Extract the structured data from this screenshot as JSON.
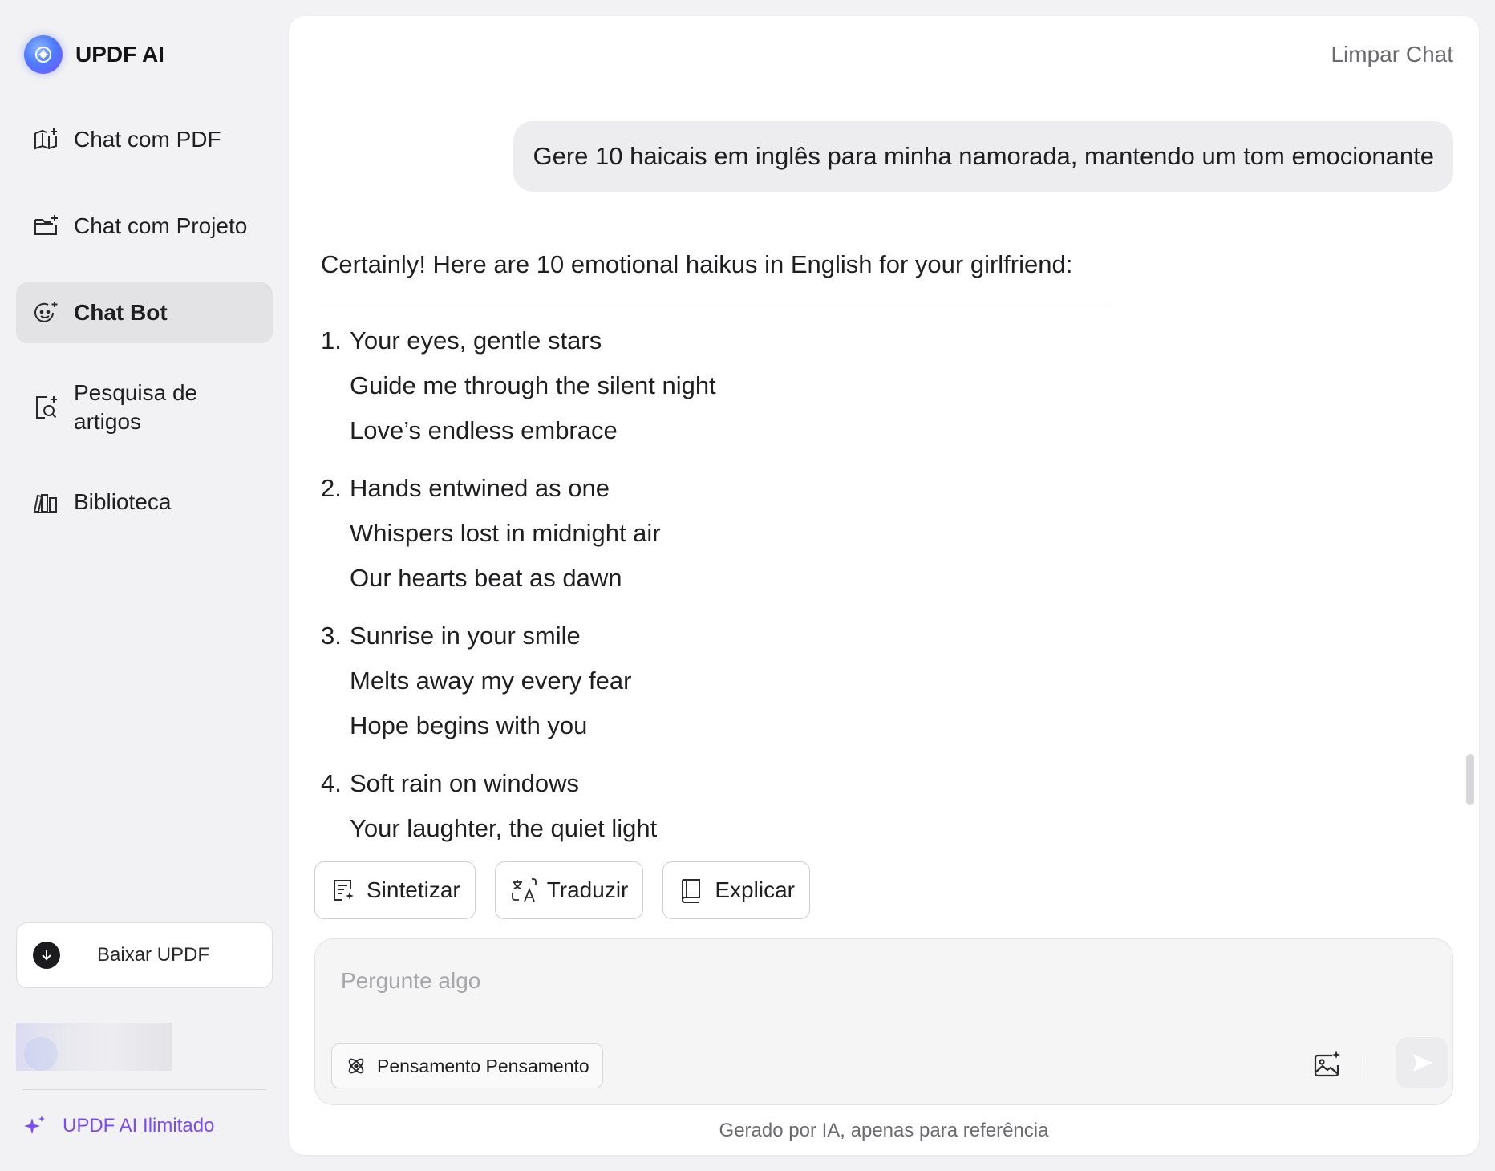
{
  "brand": {
    "name": "UPDF AI"
  },
  "sidebar": {
    "items": [
      {
        "label": "Chat com PDF",
        "icon": "book-sparkle-icon"
      },
      {
        "label": "Chat com Projeto",
        "icon": "folder-sparkle-icon"
      },
      {
        "label": "Chat Bot",
        "icon": "bot-face-icon",
        "active": true
      },
      {
        "label": "Pesquisa de\nartigos",
        "icon": "document-search-icon"
      },
      {
        "label": "Biblioteca",
        "icon": "library-icon"
      }
    ],
    "download_label": "Baixar UPDF",
    "upgrade_label": "UPDF AI Ilimitado",
    "accent": "#7a4cf5"
  },
  "header": {
    "clear_chat": "Limpar Chat"
  },
  "conversation": {
    "user_message": "Gere 10 haicais em inglês para minha namorada, mantendo um tom emocionante",
    "intro": "Certainly! Here are 10 emotional haikus in English for your girlfriend:",
    "haikus": [
      {
        "num": "1.",
        "lines": [
          "Your eyes, gentle stars",
          "Guide me through the silent night",
          "Love’s endless embrace"
        ]
      },
      {
        "num": "2.",
        "lines": [
          "Hands entwined as one",
          "Whispers lost in midnight air",
          "Our hearts beat as dawn"
        ]
      },
      {
        "num": "3.",
        "lines": [
          "Sunrise in your smile",
          "Melts away my every fear",
          "Hope begins with you"
        ]
      },
      {
        "num": "4.",
        "lines": [
          "Soft rain on windows",
          "Your laughter, the quiet light"
        ]
      }
    ]
  },
  "actions": {
    "summarize": "Sintetizar",
    "translate": "Traduzir",
    "explain": "Explicar"
  },
  "composer": {
    "placeholder": "Pergunte algo",
    "value": "",
    "thinking_label": "Pensamento Pensamento"
  },
  "footer": {
    "disclaimer": "Gerado por IA, apenas para referência"
  }
}
